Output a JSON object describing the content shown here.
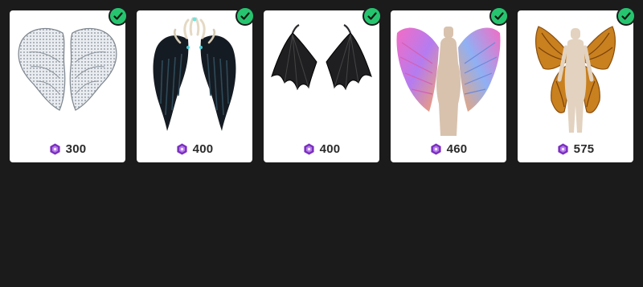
{
  "store": {
    "items": [
      {
        "name": "White diamond angel wings",
        "price": "300",
        "owned": true,
        "art_icon": "angel-wings-icon",
        "currency_icon": "gem-currency-icon"
      },
      {
        "name": "Dark feather wings with crown",
        "price": "400",
        "owned": true,
        "art_icon": "dark-feather-wings-icon",
        "currency_icon": "gem-currency-icon"
      },
      {
        "name": "Black bat wings",
        "price": "400",
        "owned": true,
        "art_icon": "bat-wings-icon",
        "currency_icon": "gem-currency-icon"
      },
      {
        "name": "Pastel rainbow wings",
        "price": "460",
        "owned": true,
        "art_icon": "rainbow-wings-icon",
        "currency_icon": "gem-currency-icon"
      },
      {
        "name": "Orange butterfly wings",
        "price": "575",
        "owned": true,
        "art_icon": "butterfly-wings-icon",
        "currency_icon": "gem-currency-icon"
      }
    ]
  },
  "colors": {
    "background": "#1b1b1c",
    "card": "#ffffff",
    "owned_badge": "#27c46f",
    "currency": "#7a2fbf"
  }
}
